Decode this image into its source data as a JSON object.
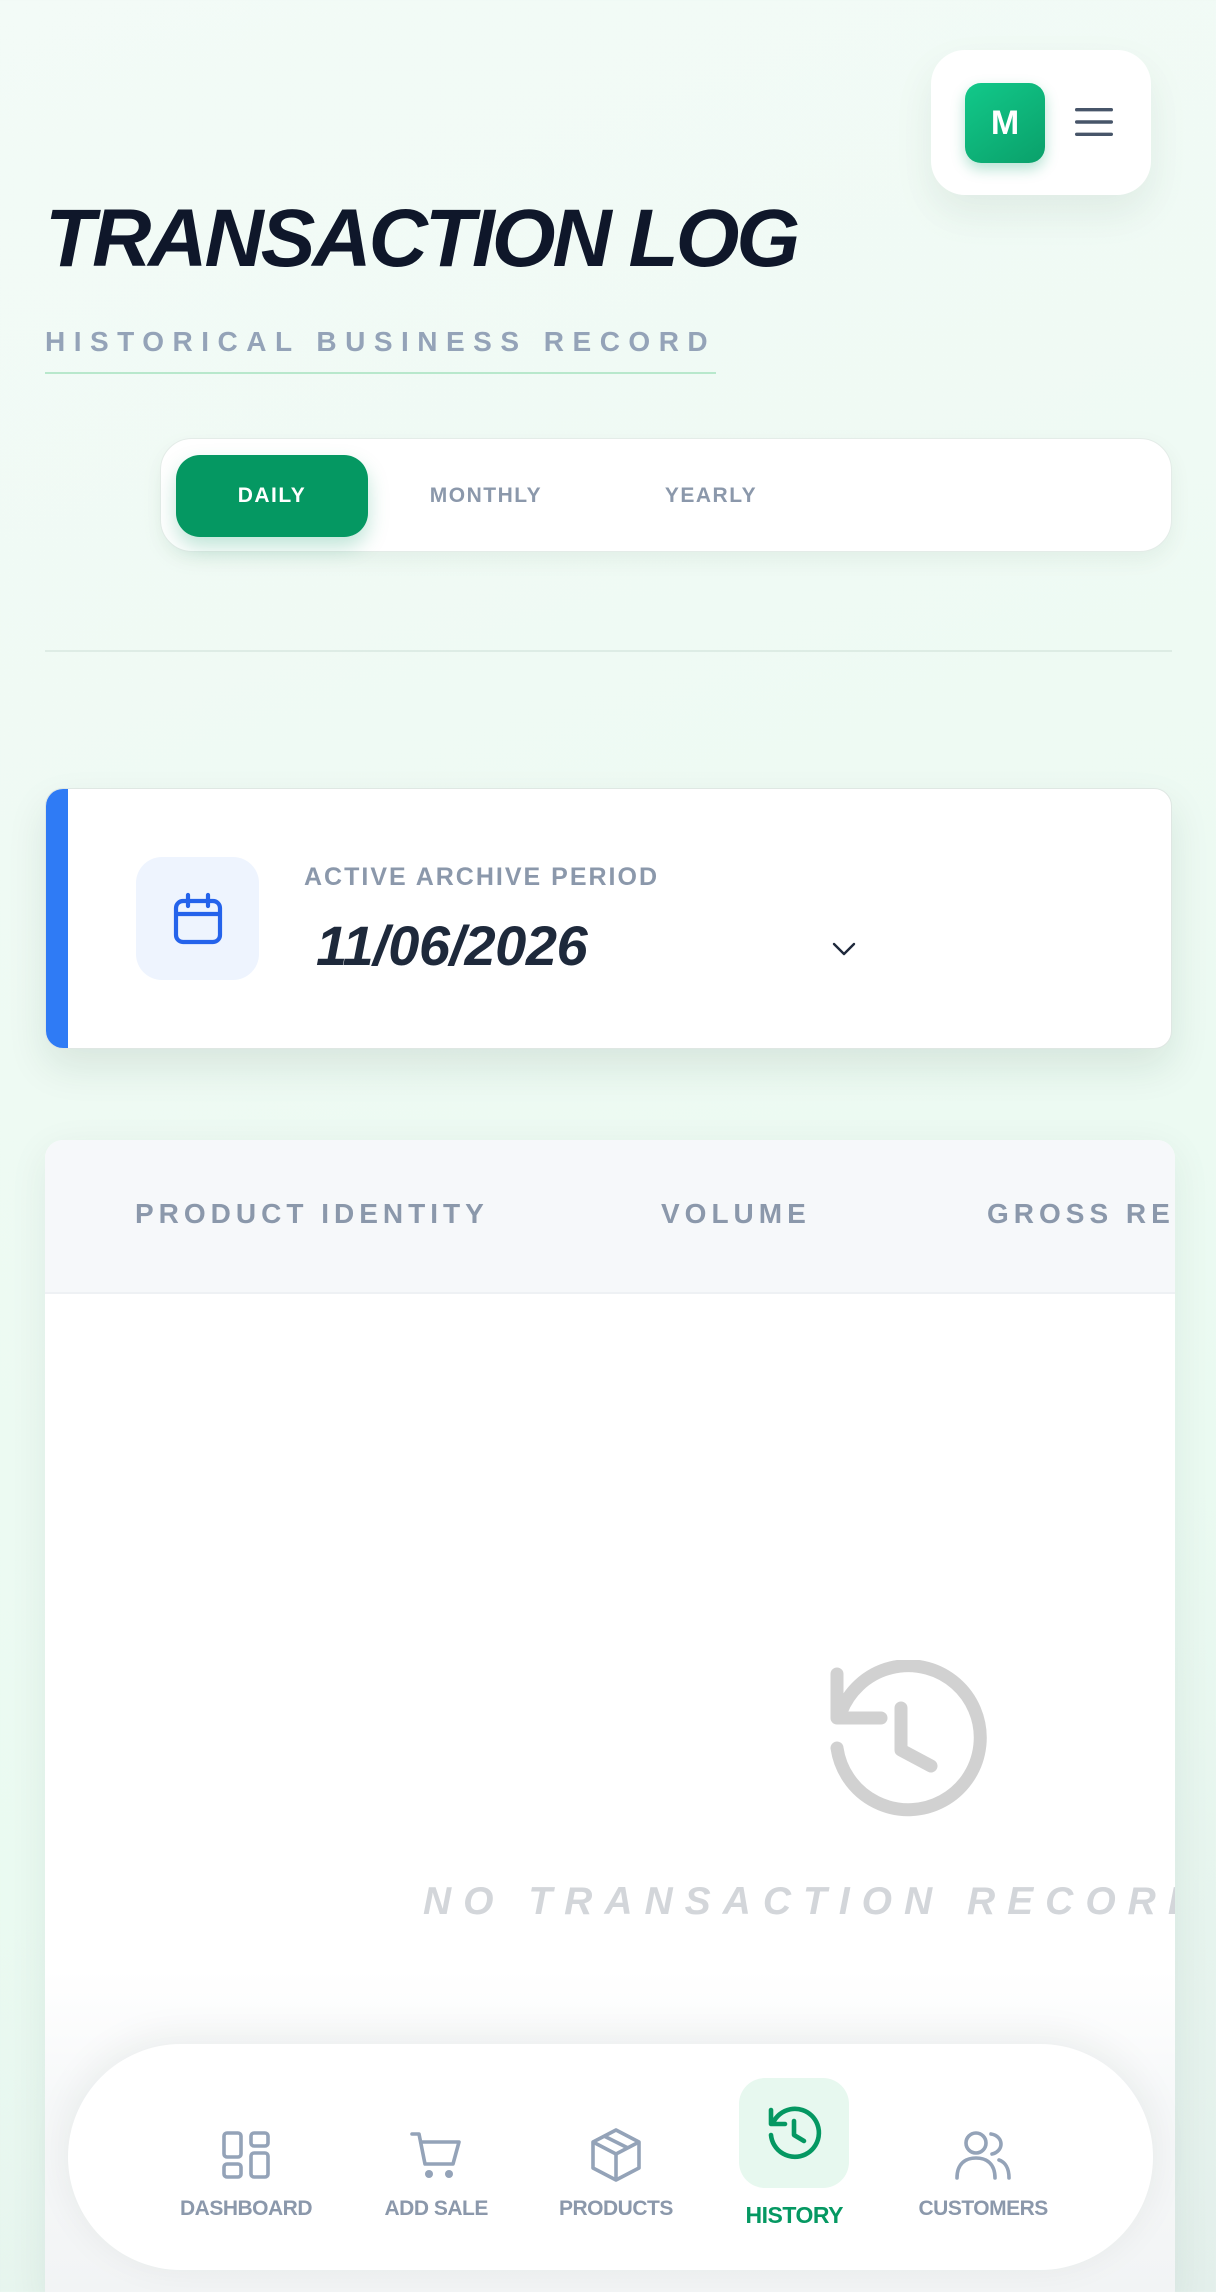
{
  "header": {
    "avatar_initial": "M",
    "title": "TRANSACTION LOG",
    "subtitle": "HISTORICAL BUSINESS RECORD"
  },
  "tabs": [
    {
      "label": "DAILY",
      "active": true
    },
    {
      "label": "MONTHLY",
      "active": false
    },
    {
      "label": "YEARLY",
      "active": false
    }
  ],
  "period": {
    "label": "ACTIVE ARCHIVE PERIOD",
    "value": "11/06/2026"
  },
  "table": {
    "columns": [
      "PRODUCT IDENTITY",
      "VOLUME",
      "GROSS REV"
    ],
    "rows": [],
    "empty_message": "NO TRANSACTION RECORDS"
  },
  "nav": {
    "items": [
      {
        "label": "DASHBOARD",
        "icon": "grid-icon",
        "active": false
      },
      {
        "label": "ADD SALE",
        "icon": "cart-icon",
        "active": false
      },
      {
        "label": "PRODUCTS",
        "icon": "box-icon",
        "active": false
      },
      {
        "label": "HISTORY",
        "icon": "history-icon",
        "active": true
      },
      {
        "label": "CUSTOMERS",
        "icon": "users-icon",
        "active": false
      }
    ]
  },
  "colors": {
    "accent_green": "#059862",
    "accent_blue": "#2f7bf5",
    "title_dark": "#0f172a",
    "muted_text": "#8b98ab"
  }
}
